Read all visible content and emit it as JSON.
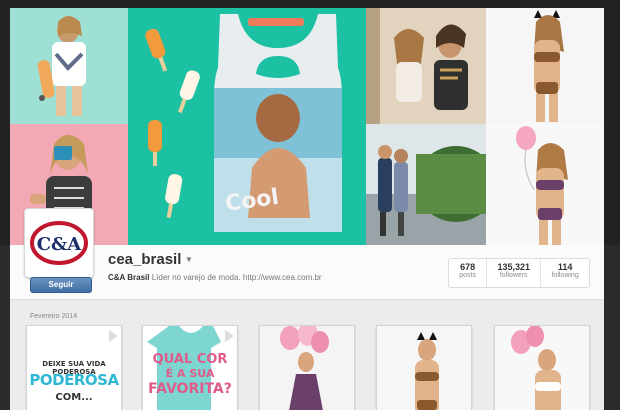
{
  "profile": {
    "username": "cea_brasil",
    "full_name": "C&A Brasil",
    "bio": "Líder no varejo de moda. http://www.cea.com.br",
    "follow_label": "Seguir",
    "logo_text": "C&A"
  },
  "stats": [
    {
      "value": "678",
      "label": "posts"
    },
    {
      "value": "135,321",
      "label": "followers"
    },
    {
      "value": "114",
      "label": "following"
    }
  ],
  "feed": {
    "month_label": "Fevereiro 2014",
    "thumb1": {
      "line1": "DEIXE SUA VIDA PODEROSA",
      "line2": "PODEROSA",
      "line3": "COM..."
    },
    "thumb2": {
      "line1": "QUAL COR",
      "line2": "É A SUA",
      "line3": "FAVORITA?"
    }
  },
  "header": {
    "tank_text": "Cool"
  },
  "colors": {
    "accent": "#3f6fa6",
    "logo_red": "#c0172e",
    "logo_navy": "#1c2f6b",
    "mint": "#1cc0a3"
  }
}
